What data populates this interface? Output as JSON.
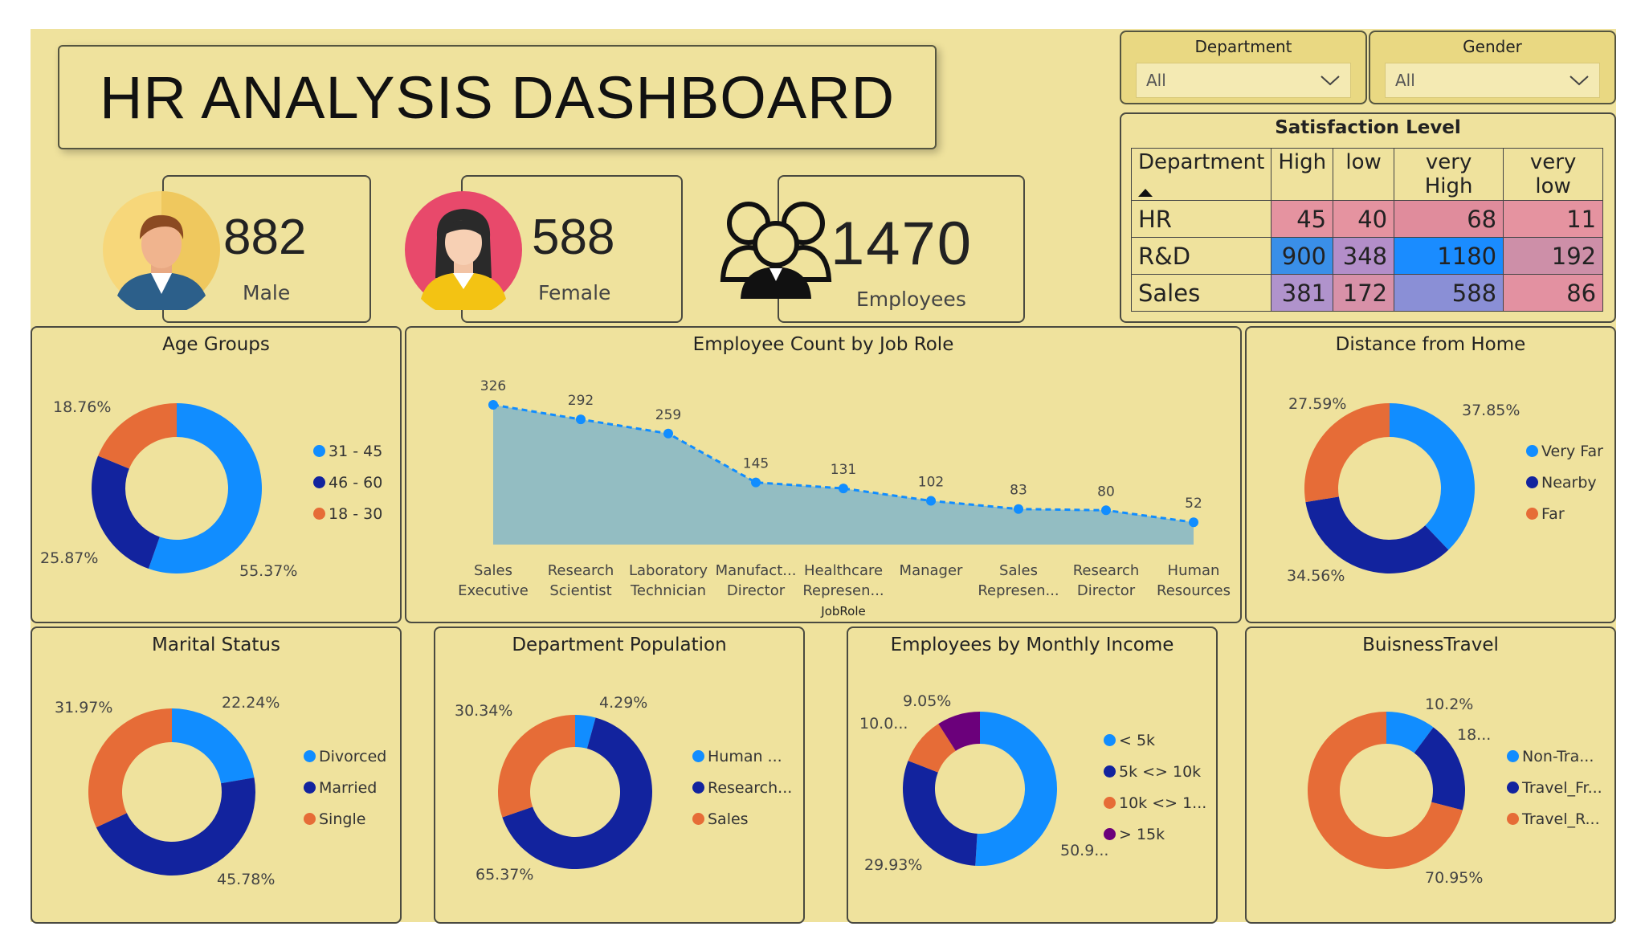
{
  "title": "HR ANALYSIS DASHBOARD",
  "slicers": {
    "department": {
      "label": "Department",
      "value": "All"
    },
    "gender": {
      "label": "Gender",
      "value": "All"
    }
  },
  "kpis": {
    "male": {
      "value": "882",
      "label": "Male",
      "icon": "male-avatar-icon"
    },
    "female": {
      "value": "588",
      "label": "Female",
      "icon": "female-avatar-icon"
    },
    "employees": {
      "value": "1470",
      "label": "Employees",
      "icon": "people-group-icon"
    }
  },
  "satisfaction": {
    "title": "Satisfaction Level",
    "columns": [
      "Department",
      "High",
      "low",
      "very High",
      "very low"
    ],
    "rows": [
      {
        "dept": "HR",
        "values": [
          "45",
          "40",
          "68",
          "11"
        ],
        "colors": [
          "#e593a0",
          "#e593a0",
          "#e08c9c",
          "#e593a0"
        ]
      },
      {
        "dept": "R&D",
        "values": [
          "900",
          "348",
          "1180",
          "192"
        ],
        "colors": [
          "#3a8fe8",
          "#b38ec9",
          "#1a8cff",
          "#cd8fa8"
        ]
      },
      {
        "dept": "Sales",
        "values": [
          "381",
          "172",
          "588",
          "86"
        ],
        "colors": [
          "#b093cc",
          "#d891a8",
          "#8a8fd6",
          "#e391a1"
        ]
      }
    ]
  },
  "age_groups": {
    "title": "Age Groups",
    "legend": [
      "31 - 45",
      "46 - 60",
      "18 - 30"
    ],
    "labels": [
      "55.37%",
      "25.87%",
      "18.76%"
    ]
  },
  "job_role": {
    "title": "Employee Count by Job Role",
    "axis_title": "JobRole",
    "categories": [
      [
        "Sales",
        "Executive"
      ],
      [
        "Research",
        "Scientist"
      ],
      [
        "Laboratory",
        "Technician"
      ],
      [
        "Manufact...",
        "Director"
      ],
      [
        "Healthcare",
        "Represen..."
      ],
      [
        "Manager",
        ""
      ],
      [
        "Sales",
        "Represen..."
      ],
      [
        "Research",
        "Director"
      ],
      [
        "Human",
        "Resources"
      ]
    ],
    "values": [
      326,
      292,
      259,
      145,
      131,
      102,
      83,
      80,
      52
    ]
  },
  "distance": {
    "title": "Distance from Home",
    "legend": [
      "Very Far",
      "Nearby",
      "Far"
    ],
    "labels": [
      "37.85%",
      "34.56%",
      "27.59%"
    ]
  },
  "marital": {
    "title": "Marital Status",
    "legend": [
      "Divorced",
      "Married",
      "Single"
    ],
    "labels": [
      "22.24%",
      "45.78%",
      "31.97%"
    ]
  },
  "dept_population": {
    "title": "Department Population",
    "legend": [
      "Human ...",
      "Research...",
      "Sales"
    ],
    "labels": [
      "4.29%",
      "65.37%",
      "30.34%"
    ]
  },
  "income": {
    "title": "Employees by Monthly Income",
    "legend": [
      "< 5k",
      "5k <> 10k",
      "10k <> 1...",
      "> 15k"
    ],
    "labels": [
      "50.9...",
      "29.93%",
      "10.0...",
      "9.05%"
    ]
  },
  "travel": {
    "title": "BuisnessTravel",
    "legend": [
      "Non-Tra...",
      "Travel_Fr...",
      "Travel_R..."
    ],
    "labels": [
      "10.2%",
      "18...",
      "70.95%"
    ]
  },
  "colors": {
    "background": "#efe29d",
    "light_blue": "#118dff",
    "dark_blue": "#12239e",
    "orange": "#e66c37",
    "purple": "#6b007b",
    "area_fill": "#93bdc2"
  },
  "chart_data": [
    {
      "type": "pie",
      "title": "Age Groups",
      "categories": [
        "31 - 45",
        "46 - 60",
        "18 - 30"
      ],
      "values": [
        55.37,
        25.87,
        18.76
      ]
    },
    {
      "type": "area",
      "title": "Employee Count by Job Role",
      "xlabel": "JobRole",
      "categories": [
        "Sales Executive",
        "Research Scientist",
        "Laboratory Technician",
        "Manufact... Director",
        "Healthcare Represen...",
        "Manager",
        "Sales Represen...",
        "Research Director",
        "Human Resources"
      ],
      "values": [
        326,
        292,
        259,
        145,
        131,
        102,
        83,
        80,
        52
      ]
    },
    {
      "type": "pie",
      "title": "Distance from Home",
      "categories": [
        "Very Far",
        "Nearby",
        "Far"
      ],
      "values": [
        37.85,
        34.56,
        27.59
      ]
    },
    {
      "type": "pie",
      "title": "Marital Status",
      "categories": [
        "Divorced",
        "Married",
        "Single"
      ],
      "values": [
        22.24,
        45.78,
        31.97
      ]
    },
    {
      "type": "pie",
      "title": "Department Population",
      "categories": [
        "Human ...",
        "Research...",
        "Sales"
      ],
      "values": [
        4.29,
        65.37,
        30.34
      ]
    },
    {
      "type": "pie",
      "title": "Employees by Monthly Income",
      "categories": [
        "< 5k",
        "5k <> 10k",
        "10k <> 1...",
        "> 15k"
      ],
      "values": [
        50.9,
        29.93,
        10.0,
        9.05
      ]
    },
    {
      "type": "pie",
      "title": "BuisnessTravel",
      "categories": [
        "Non-Tra...",
        "Travel_Fr...",
        "Travel_R..."
      ],
      "values": [
        10.2,
        18.85,
        70.95
      ]
    }
  ]
}
